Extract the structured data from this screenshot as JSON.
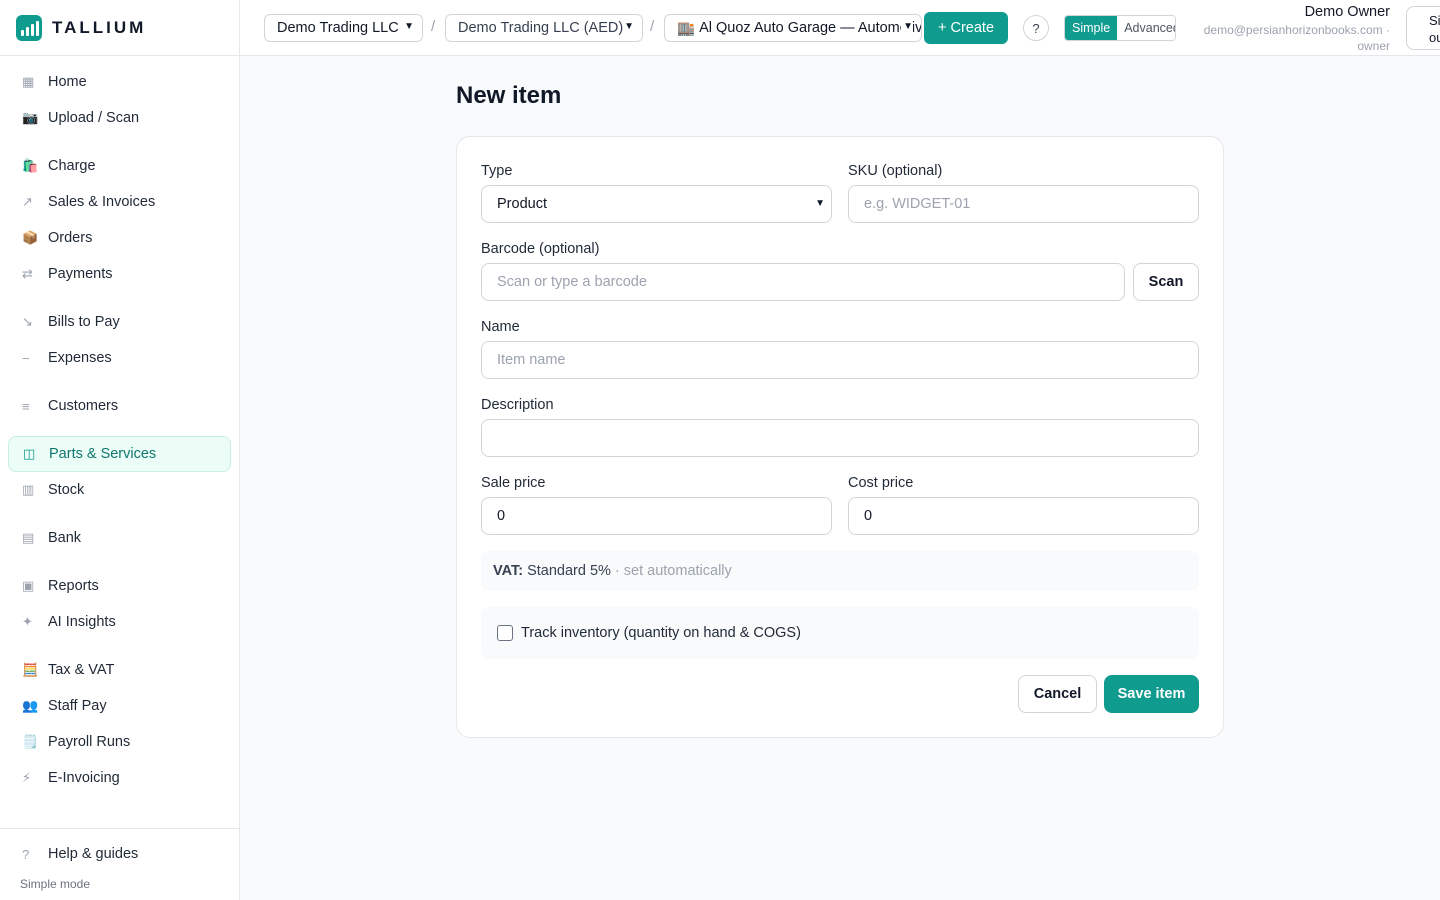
{
  "brand": {
    "name": "TALLIUM",
    "accent": "#0f9b8e"
  },
  "sidebar": {
    "items": [
      {
        "label": "Home",
        "icon": "grid-icon",
        "glyph": "▦"
      },
      {
        "label": "Upload / Scan",
        "icon": "camera-icon",
        "glyph": "📷"
      },
      {
        "label": "Charge",
        "icon": "shopping-bags-icon",
        "glyph": "🛍️"
      },
      {
        "label": "Sales & Invoices",
        "icon": "arrow-up-right-icon",
        "glyph": "↗"
      },
      {
        "label": "Orders",
        "icon": "package-icon",
        "glyph": "📦"
      },
      {
        "label": "Payments",
        "icon": "arrows-exchange-icon",
        "glyph": "⇄"
      },
      {
        "label": "Bills to Pay",
        "icon": "arrow-down-right-icon",
        "glyph": "↘"
      },
      {
        "label": "Expenses",
        "icon": "minus-icon",
        "glyph": "−"
      },
      {
        "label": "Customers",
        "icon": "list-icon",
        "glyph": "≡"
      },
      {
        "label": "Parts & Services",
        "icon": "columns-icon",
        "glyph": "◫"
      },
      {
        "label": "Stock",
        "icon": "stock-columns-icon",
        "glyph": "▥"
      },
      {
        "label": "Bank",
        "icon": "bank-icon",
        "glyph": "▤"
      },
      {
        "label": "Reports",
        "icon": "report-icon",
        "glyph": "▣"
      },
      {
        "label": "AI Insights",
        "icon": "sparkle-icon",
        "glyph": "✦"
      },
      {
        "label": "Tax & VAT",
        "icon": "abacus-icon",
        "glyph": "🧮"
      },
      {
        "label": "Staff Pay",
        "icon": "people-icon",
        "glyph": "👥"
      },
      {
        "label": "Payroll Runs",
        "icon": "notepad-icon",
        "glyph": "🗒️"
      },
      {
        "label": "E-Invoicing",
        "icon": "lightning-icon",
        "glyph": "⚡"
      }
    ],
    "help": {
      "label": "Help & guides",
      "glyph": "?"
    },
    "mode_text": "Simple mode"
  },
  "topbar": {
    "company": "Demo Trading LLC",
    "ledger": "Demo Trading LLC (AED)",
    "branch_glyph": "🏬",
    "branch": "Al Quoz Auto Garage — Automotive",
    "separator": "/",
    "create_label": "+ Create",
    "help_glyph": "?",
    "mode_simple": "Simple",
    "mode_advanced": "Advanced",
    "user_name": "Demo Owner",
    "user_email": "demo@persianhorizonbooks.com ·",
    "user_role": "owner",
    "signout_label": "Sign out"
  },
  "form": {
    "title": "New item",
    "type_label": "Type",
    "type_value": "Product",
    "sku_label": "SKU (optional)",
    "sku_placeholder": "e.g. WIDGET-01",
    "barcode_label": "Barcode (optional)",
    "barcode_placeholder": "Scan or type a barcode",
    "scan_label": "Scan",
    "name_label": "Name",
    "name_placeholder": "Item name",
    "description_label": "Description",
    "description_value": "",
    "sale_price_label": "Sale price",
    "sale_price_value": "0",
    "cost_price_label": "Cost price",
    "cost_price_value": "0",
    "vat_key": "VAT:",
    "vat_value": "Standard 5%",
    "vat_note": "· set automatically",
    "track_inventory_label": "Track inventory (quantity on hand & COGS)",
    "track_inventory_checked": false,
    "cancel_label": "Cancel",
    "save_label": "Save item"
  }
}
